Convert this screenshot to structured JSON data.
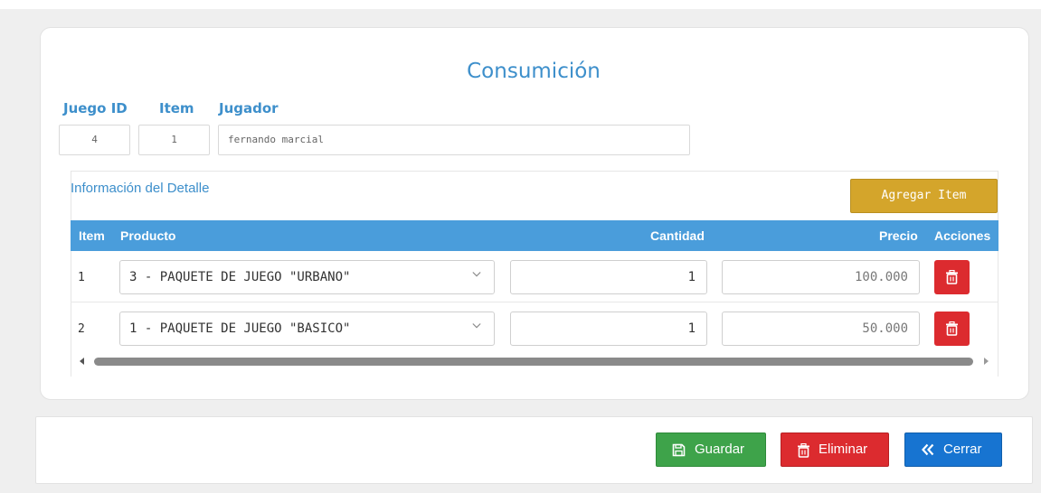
{
  "title": "Consumición",
  "header": {
    "juego_id_label": "Juego ID",
    "item_label": "Item",
    "jugador_label": "Jugador",
    "juego_id_value": "4",
    "item_value": "1",
    "jugador_value": "fernando marcial"
  },
  "detail": {
    "title": "Información del Detalle",
    "add_button": "Agregar Item",
    "columns": {
      "item": "Item",
      "producto": "Producto",
      "cantidad": "Cantidad",
      "precio": "Precio",
      "acciones": "Acciones"
    },
    "rows": [
      {
        "item": "1",
        "producto": "3 - PAQUETE DE JUEGO \"URBANO\"",
        "cantidad": "1",
        "precio": "100.000"
      },
      {
        "item": "2",
        "producto": "1 - PAQUETE DE JUEGO \"BASICO\"",
        "cantidad": "1",
        "precio": "50.000"
      }
    ]
  },
  "footer": {
    "save": "Guardar",
    "delete": "Eliminar",
    "close": "Cerrar"
  },
  "colors": {
    "accent": "#3d8fcb",
    "table_header": "#4a9ddb",
    "add_button": "#d4a52b",
    "danger": "#dc2b2f",
    "success": "#3ea34a",
    "primary": "#1774d1"
  },
  "icons": {
    "row_action": "trash-icon",
    "select": "chevron-down-icon",
    "save": "floppy-disk-icon",
    "delete": "trash-icon",
    "close": "double-chevron-left-icon"
  }
}
